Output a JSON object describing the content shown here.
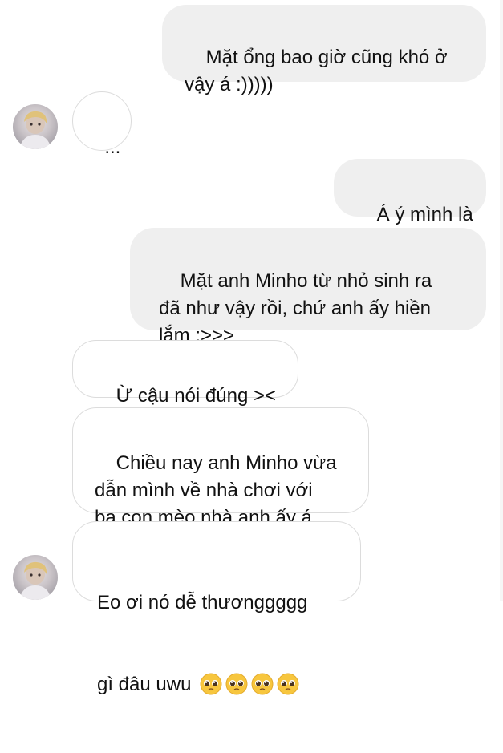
{
  "messages": [
    {
      "id": "m1",
      "direction": "outgoing",
      "text": "Mặt ổng bao giờ cũng khó ở\nvậy á :)))))"
    },
    {
      "id": "m2",
      "direction": "incoming",
      "text": "..."
    },
    {
      "id": "m3",
      "direction": "outgoing",
      "text": "Á ý mình là"
    },
    {
      "id": "m4",
      "direction": "outgoing",
      "text": "Mặt anh Minho từ nhỏ sinh ra\nđã như vậy rồi, chứ anh ấy hiền\nlắm :>>>"
    },
    {
      "id": "m5",
      "direction": "incoming",
      "text": "Ừ cậu nói đúng ><"
    },
    {
      "id": "m6",
      "direction": "incoming",
      "text": "Chiều nay anh Minho vừa\ndẫn mình về nhà chơi với\nba con mèo nhà anh ấy á"
    },
    {
      "id": "m7",
      "direction": "incoming",
      "text_line1": "Eo ơi nó dễ thươnggggg",
      "text_line2": "gì đâu uwu",
      "emojis": [
        "pleading-face",
        "pleading-face",
        "pleading-face",
        "pleading-face"
      ]
    }
  ],
  "colors": {
    "outgoing_bubble": "#efefef",
    "incoming_border": "#dcdcdc",
    "text": "#111111"
  }
}
